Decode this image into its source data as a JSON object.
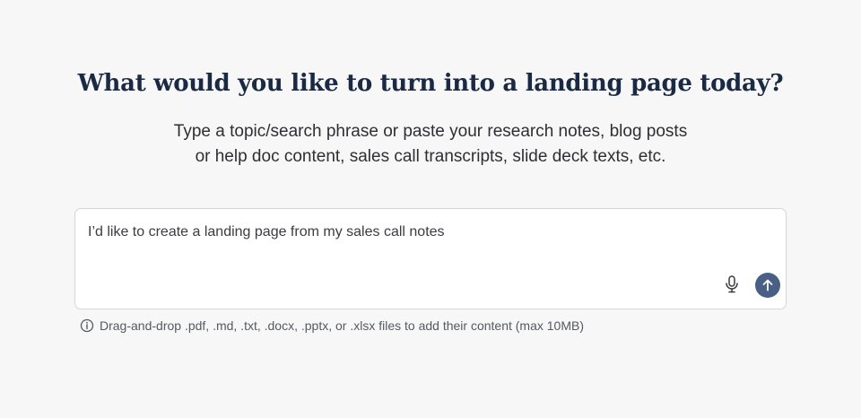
{
  "header": {
    "title": "What would you like to turn into a landing page today?",
    "subtitle_line1": "Type a topic/search phrase or paste your research notes, blog posts",
    "subtitle_line2": "or help doc content, sales call transcripts, slide deck texts, etc."
  },
  "prompt_input": {
    "value": "I’d like to create a landing page from my sales call notes",
    "mic_icon": "microphone-icon",
    "send_icon": "arrow-up-icon",
    "send_color": "#4a5f86"
  },
  "hint": {
    "icon": "info-icon",
    "text": "Drag-and-drop .pdf, .md, .txt, .docx, .pptx, or .xlsx files to add their content (max 10MB)"
  }
}
